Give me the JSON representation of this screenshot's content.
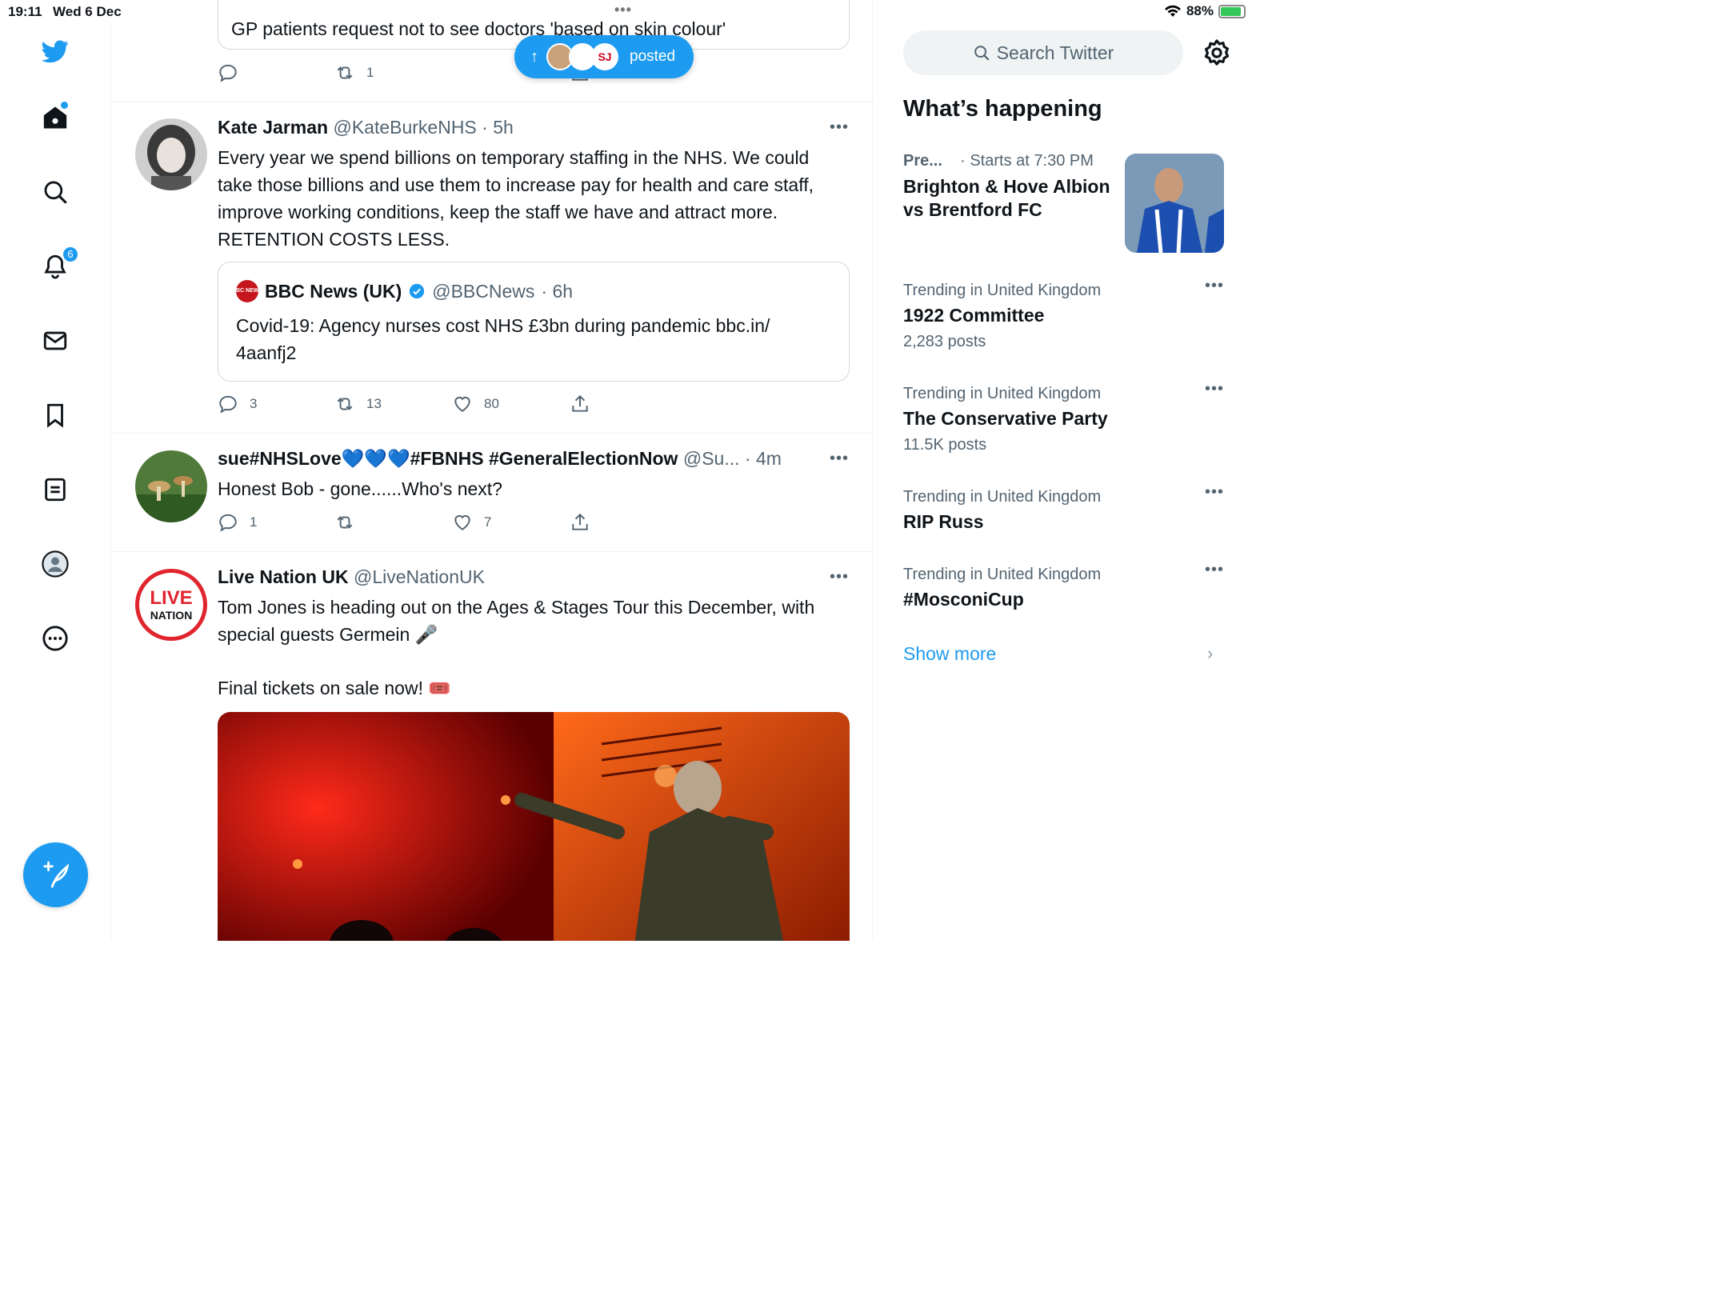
{
  "status_bar": {
    "time": "19:11",
    "date": "Wed 6 Dec",
    "battery": "88%"
  },
  "nav": {
    "notifications_badge": "6"
  },
  "new_posts_pill": {
    "arrow": "↑",
    "label": "posted",
    "avatar3_text": "SJ"
  },
  "timeline": {
    "prev_tweet": {
      "card_text": "GP patients request not to see doctors 'based on skin colour'",
      "retweets": "1"
    },
    "tweets": [
      {
        "name": "Kate Jarman",
        "handle": "@KateBurkeNHS",
        "time": "· 5h",
        "text": "Every year we spend billions on temporary staffing in the NHS. We could take those billions and use them to increase pay for health and care staff, improve working conditions, keep the staff we have and attract more. RETENTION COSTS LESS.",
        "quote": {
          "logo": "BBC NEWS",
          "name": "BBC News (UK)",
          "handle": "@BBCNews",
          "time": "· 6h",
          "text": "Covid-19: Agency nurses cost NHS £3bn during pandemic bbc.in/ 4aanfj2"
        },
        "replies": "3",
        "retweets": "13",
        "likes": "80"
      },
      {
        "name": "sue#NHSLove💙💙💙#FBNHS #GeneralElectionNow",
        "handle": "@Su...",
        "time": "· 4m",
        "text": "Honest Bob - gone......Who's next?",
        "replies": "1",
        "retweets": "",
        "likes": "7"
      },
      {
        "name": "Live Nation UK",
        "handle": "@LiveNationUK",
        "time": "",
        "avatar_text_top": "LIVE",
        "avatar_text_bottom": "NATION",
        "text_line1": "Tom Jones is heading out on the Ages & Stages Tour this December, with special guests Germein 🎤",
        "text_line2": "Final tickets on sale now! 🎟️"
      }
    ]
  },
  "sidebar": {
    "search_placeholder": "Search Twitter",
    "whats_happening": "What’s happening",
    "event": {
      "category": "Pre...",
      "time": "· Starts at 7:30 PM",
      "title": "Brighton & Hove Albion vs Brentford FC"
    },
    "trends": [
      {
        "category": "Trending in United Kingdom",
        "name": "1922 Committee",
        "posts": "2,283 posts"
      },
      {
        "category": "Trending in United Kingdom",
        "name": "The Conservative Party",
        "posts": "11.5K posts"
      },
      {
        "category": "Trending in United Kingdom",
        "name": "RIP Russ",
        "posts": ""
      },
      {
        "category": "Trending in United Kingdom",
        "name": "#MosconiCup",
        "posts": ""
      }
    ],
    "show_more": "Show more"
  },
  "colors": {
    "accent": "#1d9bf0",
    "text": "#0f1419",
    "secondary": "#536471",
    "border": "#eff3f4"
  }
}
